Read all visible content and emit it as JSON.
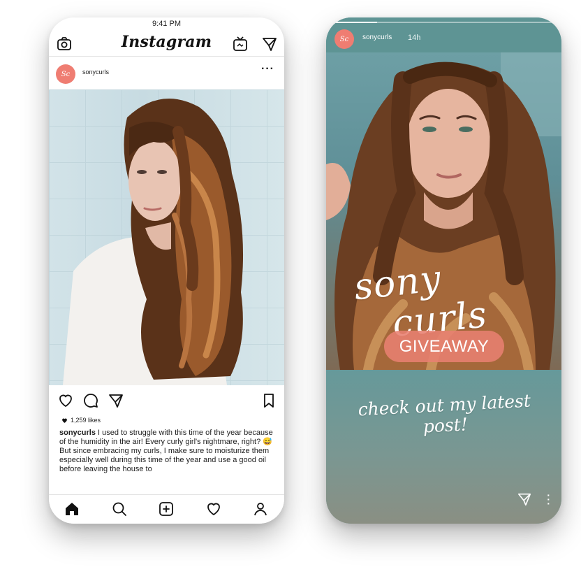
{
  "feed": {
    "status_time": "9:41 PM",
    "app_title": "Instagram",
    "post": {
      "avatar_initials": "Sc",
      "username": "sonycurls",
      "likes": "1,259 likes",
      "caption_user": "sonycurls",
      "caption_text": "I used to struggle with this time of the year because of the humidity in the air! Every curly girl's nightmare, right? 😅",
      "caption_more": "But since embracing my curls, I make sure to moisturize them especially well during this time of the year and use a good oil before leaving the house to"
    }
  },
  "story": {
    "avatar_initials": "Sc",
    "username": "sonycurls",
    "time": "14h",
    "progress": 0.2,
    "brand_line1": "sony",
    "brand_line2": "curls",
    "badge": "GIVEAWAY",
    "cta": "check out my latest post!"
  },
  "colors": {
    "accent": "#ef7d72",
    "story_teal": "#6fa0a1"
  }
}
